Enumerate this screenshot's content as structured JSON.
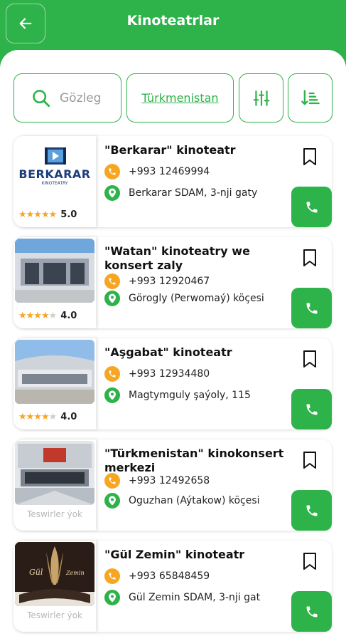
{
  "header": {
    "title": "Kinoteatrlar",
    "back_icon": "arrow-left-icon"
  },
  "filters": {
    "search_placeholder": "Gözleg",
    "country": "Türkmenistan"
  },
  "colors": {
    "brand": "#2eb24a",
    "star": "#f6a623",
    "phone_badge": "#f6a623"
  },
  "cinemas": [
    {
      "name": "\"Berkarar\" kinoteatr",
      "phone": "+993 12469994",
      "address": "Berkarar SDAM, 3-nji gaty",
      "rating": "5.0",
      "stars": 5,
      "image_text": "BERKARAR",
      "image_sub": "KINOTEATRY"
    },
    {
      "name": "\"Watan\" kinoteatry we konsert zaly",
      "phone": "+993 12920467",
      "address": "Görogly (Perwomaý) köçesi",
      "rating": "4.0",
      "stars": 4
    },
    {
      "name": "\"Aşgabat\" kinoteatr",
      "phone": "+993 12934480",
      "address": "Magtymguly şaýoly, 115",
      "rating": "4.0",
      "stars": 4
    },
    {
      "name": "\"Türkmenistan\" kinokonsert merkezi",
      "phone": "+993 12492658",
      "address": "Oguzhan (Aýtakow) köçesi",
      "no_image_note": "Teswirler ýok"
    },
    {
      "name": "\"Gül Zemin\" kinoteatr",
      "phone": "+993 65848459",
      "address": "Gül Zemin SDAM, 3-nji gat",
      "no_image_note": "Teswirler ýok"
    }
  ]
}
